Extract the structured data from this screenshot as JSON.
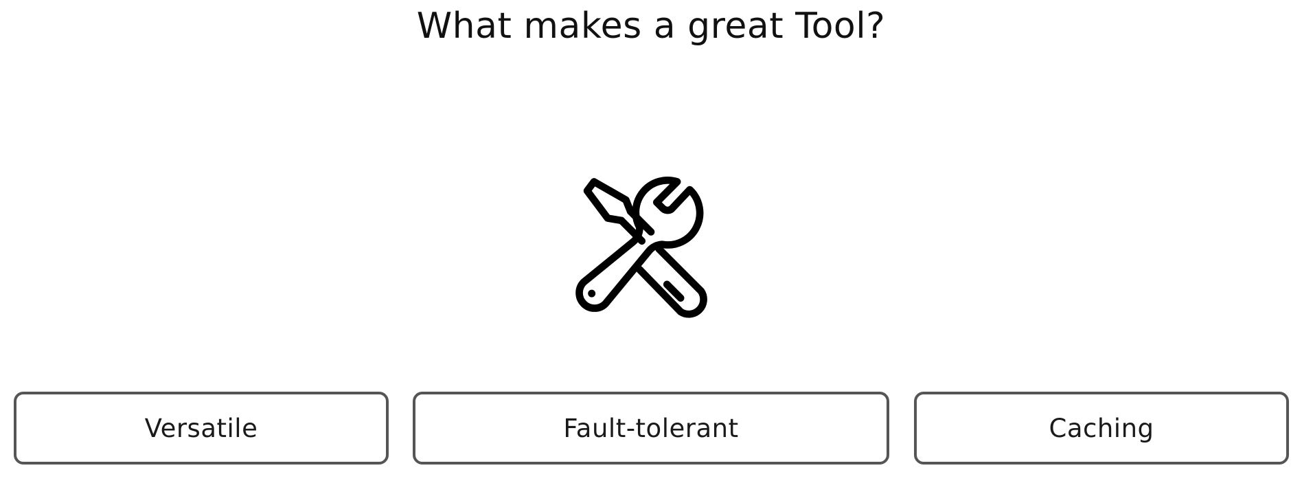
{
  "question": {
    "title": "What makes a great Tool?"
  },
  "illustration": {
    "icon": "wrench-screwdriver-icon",
    "stroke_color": "#000000"
  },
  "options": [
    {
      "label": "Versatile"
    },
    {
      "label": "Fault-tolerant"
    },
    {
      "label": "Caching"
    }
  ],
  "colors": {
    "background": "#ffffff",
    "text": "#111111",
    "option_border": "#555555"
  }
}
